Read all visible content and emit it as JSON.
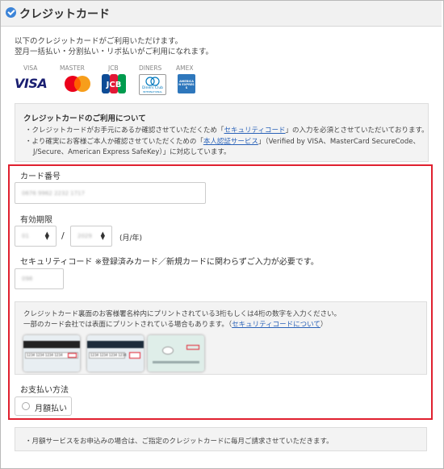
{
  "header": {
    "title": "クレジットカード"
  },
  "intro": {
    "line1": "以下のクレジットカードがご利用いただけます。",
    "line2": "翌月一括払い・分割払い・リボ払いがご利用になれます。"
  },
  "brands": [
    {
      "name": "VISA",
      "logo_text": "VISA",
      "icon": "visa-logo"
    },
    {
      "name": "MASTER",
      "logo_text": "",
      "icon": "mastercard-logo"
    },
    {
      "name": "JCB",
      "logo_text": "JCB",
      "icon": "jcb-logo"
    },
    {
      "name": "DINERS",
      "logo_text": "Diners Club",
      "logo_sub": "INTERNATIONAL",
      "icon": "diners-logo"
    },
    {
      "name": "AMEX",
      "logo_text": "AMERICAN EXPRESS",
      "icon": "amex-logo"
    }
  ],
  "info": {
    "title": "クレジットカードのご利用について",
    "line1_pre": "・クレジットカードがお手元にあるか確認させていただくため「",
    "line1_link": "セキュリティコード",
    "line1_post": "」の入力を必須とさせていただいております。",
    "line2_pre": "・より確実にお客様ご本人か確認させていただくための「",
    "line2_link": "本人認証サービス",
    "line2_post": "」（Verified by VISA、MasterCard SecureCode、",
    "line3": "J/Secure、American Express SafeKey）」に対応しています。"
  },
  "form": {
    "card_number_label": "カード番号",
    "card_number_value": "0676 9962 2232 1717",
    "expiry_label": "有効期限",
    "expiry_month": "01",
    "expiry_year": "2029",
    "expiry_separator": "/",
    "expiry_unit": "(月/年)",
    "security_label": "セキュリティコード ※登録済みカード／新規カードに関わらずご入力が必要です。",
    "security_value": "098"
  },
  "hint": {
    "line1": "クレジットカード裏面のお客様署名枠内にプリントされている3桁もしくは4桁の数字を入力ください。",
    "line2_pre": "一部のカード会社では表面にプリントされている場合もあります。（",
    "line2_link": "セキュリティコードについて",
    "line2_post": "）",
    "card_digits": "1234 1234 1234 1234"
  },
  "payment": {
    "label": "お支払い方法",
    "option": "月額払い"
  },
  "note": "・月額サービスをお申込みの場合は、ご指定のクレジットカードに毎月ご請求させていただきます。",
  "colors": {
    "accent": "#3c84d8",
    "highlight_border": "#e0202f",
    "link": "#2a62b8",
    "visa_blue": "#1a1f71",
    "jcb_blue": "#0e4c96",
    "amex_blue": "#2e77bc"
  }
}
